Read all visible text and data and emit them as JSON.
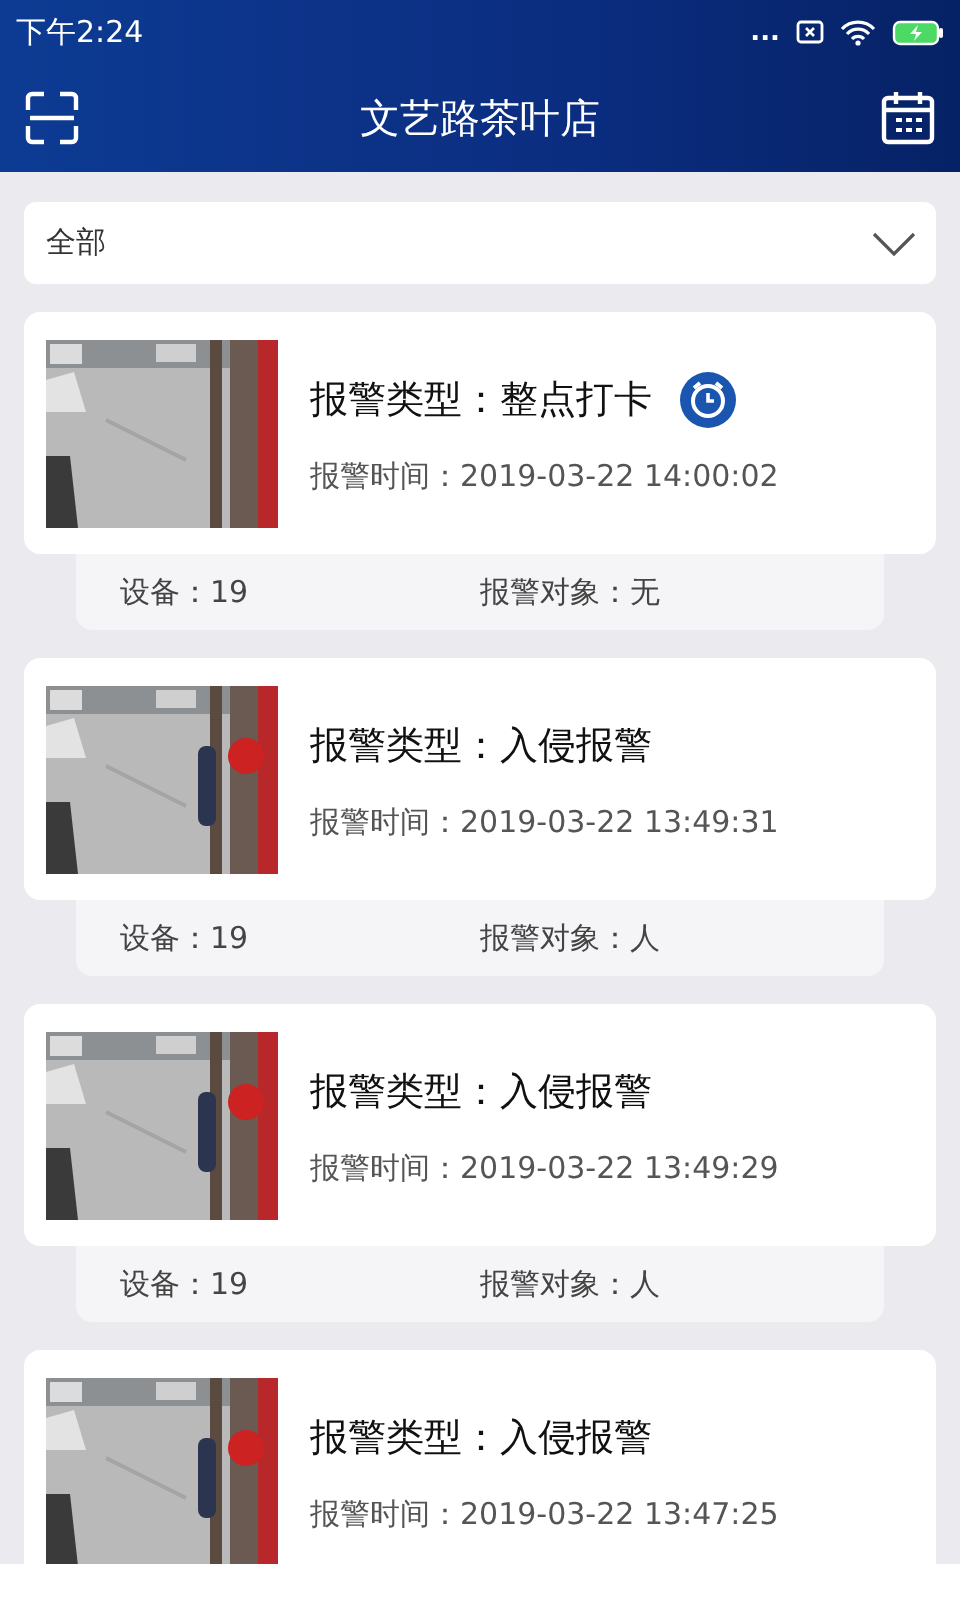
{
  "status_bar": {
    "time": "下午2:24",
    "more": "..."
  },
  "header": {
    "title": "文艺路茶叶店"
  },
  "filter": {
    "value": "全部"
  },
  "alerts": [
    {
      "type": "报警类型：整点打卡",
      "alarm_icon": true,
      "time": "报警时间：2019-03-22 14:00:02",
      "device": "设备：19",
      "target": "报警对象：无"
    },
    {
      "type": "报警类型：入侵报警",
      "alarm_icon": false,
      "time": "报警时间：2019-03-22 13:49:31",
      "device": "设备：19",
      "target": "报警对象：人"
    },
    {
      "type": "报警类型：入侵报警",
      "alarm_icon": false,
      "time": "报警时间：2019-03-22 13:49:29",
      "device": "设备：19",
      "target": "报警对象：人"
    },
    {
      "type": "报警类型：入侵报警",
      "alarm_icon": false,
      "time": "报警时间：2019-03-22 13:47:25"
    }
  ]
}
